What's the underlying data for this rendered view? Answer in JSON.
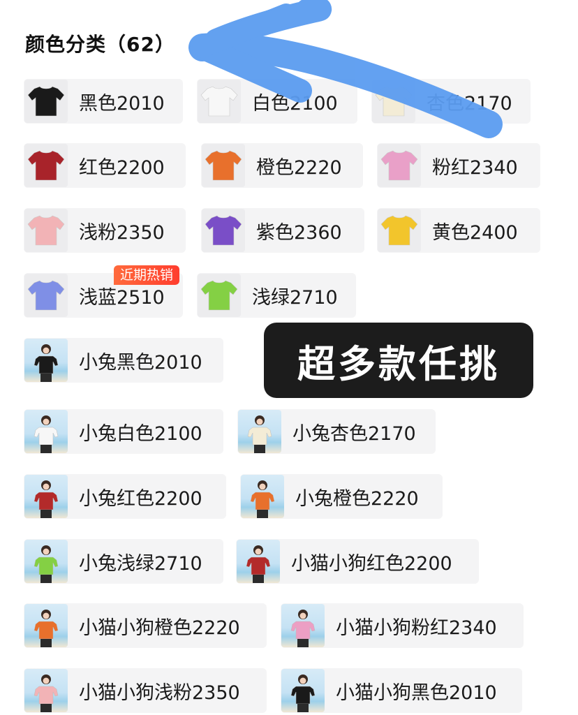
{
  "header": {
    "title": "颜色分类（62）"
  },
  "badge": {
    "text": "近期热销"
  },
  "promo": {
    "text": "超多款任挑"
  },
  "colors": {
    "arrow": "#5b9cf0",
    "badge": "#ff4a33",
    "promo_bg": "#1c1c1c"
  },
  "items": [
    {
      "label": "黑色2010",
      "shirt": "#1a1a1a",
      "style": "plain"
    },
    {
      "label": "白色2100",
      "shirt": "#f7f7f7",
      "style": "plain"
    },
    {
      "label": "杏色2170",
      "shirt": "#f3ecd6",
      "style": "plain"
    },
    {
      "label": "红色2200",
      "shirt": "#a8232a",
      "style": "plain"
    },
    {
      "label": "橙色2220",
      "shirt": "#e8702c",
      "style": "plain"
    },
    {
      "label": "粉红2340",
      "shirt": "#e9a0c8",
      "style": "plain"
    },
    {
      "label": "浅粉2350",
      "shirt": "#f2b3b6",
      "style": "plain"
    },
    {
      "label": "紫色2360",
      "shirt": "#7a4ec7",
      "style": "plain"
    },
    {
      "label": "黄色2400",
      "shirt": "#f2c52c",
      "style": "plain"
    },
    {
      "label": "浅蓝2510",
      "shirt": "#7f8fe6",
      "style": "plain"
    },
    {
      "label": "浅绿2710",
      "shirt": "#84d044",
      "style": "plain"
    },
    {
      "label": "小兔黑色2010",
      "shirt": "#1a1a1a",
      "style": "kid"
    },
    {
      "label": "小兔白色2100",
      "shirt": "#f7f7f7",
      "style": "kid"
    },
    {
      "label": "小兔杏色2170",
      "shirt": "#f3ecd6",
      "style": "kid"
    },
    {
      "label": "小兔红色2200",
      "shirt": "#b32a2a",
      "style": "kid"
    },
    {
      "label": "小兔橙色2220",
      "shirt": "#e8702c",
      "style": "kid"
    },
    {
      "label": "小兔浅绿2710",
      "shirt": "#84d044",
      "style": "kid"
    },
    {
      "label": "小猫小狗红色2200",
      "shirt": "#b32a2a",
      "style": "kid"
    },
    {
      "label": "小猫小狗橙色2220",
      "shirt": "#e8702c",
      "style": "kid"
    },
    {
      "label": "小猫小狗粉红2340",
      "shirt": "#ec9fc4",
      "style": "kid"
    },
    {
      "label": "小猫小狗浅粉2350",
      "shirt": "#f2b3b6",
      "style": "kid"
    },
    {
      "label": "小猫小狗黑色2010",
      "shirt": "#1a1a1a",
      "style": "kid"
    }
  ]
}
